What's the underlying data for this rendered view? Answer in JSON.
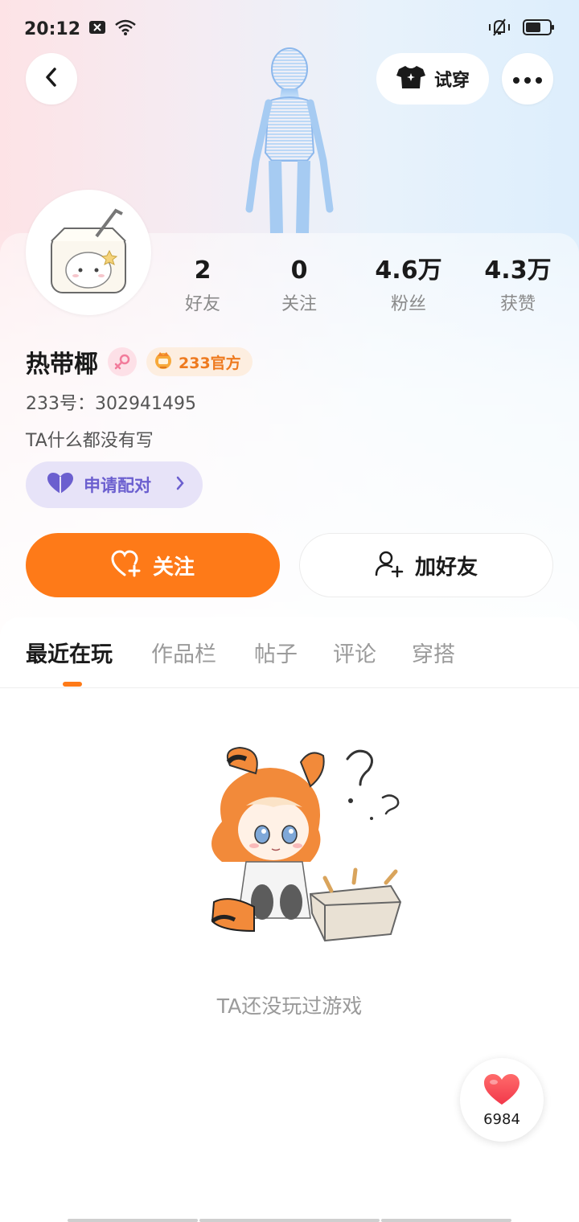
{
  "status_bar": {
    "time": "20:12"
  },
  "header": {
    "tryon_label": "试穿"
  },
  "profile": {
    "stats": [
      {
        "value": "2",
        "label": "好友"
      },
      {
        "value": "0",
        "label": "关注"
      },
      {
        "value": "4.6万",
        "label": "粉丝"
      },
      {
        "value": "4.3万",
        "label": "获赞"
      }
    ],
    "nickname": "热带椰",
    "official_badge": "233官方",
    "uid": "233号：302941495",
    "bio": "TA什么都没有写",
    "pair_label": "申请配对"
  },
  "actions": {
    "follow_label": "关注",
    "add_friend_label": "加好友"
  },
  "tabs": [
    "最近在玩",
    "作品栏",
    "帖子",
    "评论",
    "穿搭"
  ],
  "active_tab_index": 0,
  "empty_state": {
    "text": "TA还没玩过游戏"
  },
  "like_widget": {
    "count": "6984"
  },
  "colors": {
    "accent": "#fe7a18",
    "pair": "#6b5fcf",
    "official": "#ee7a1f"
  }
}
